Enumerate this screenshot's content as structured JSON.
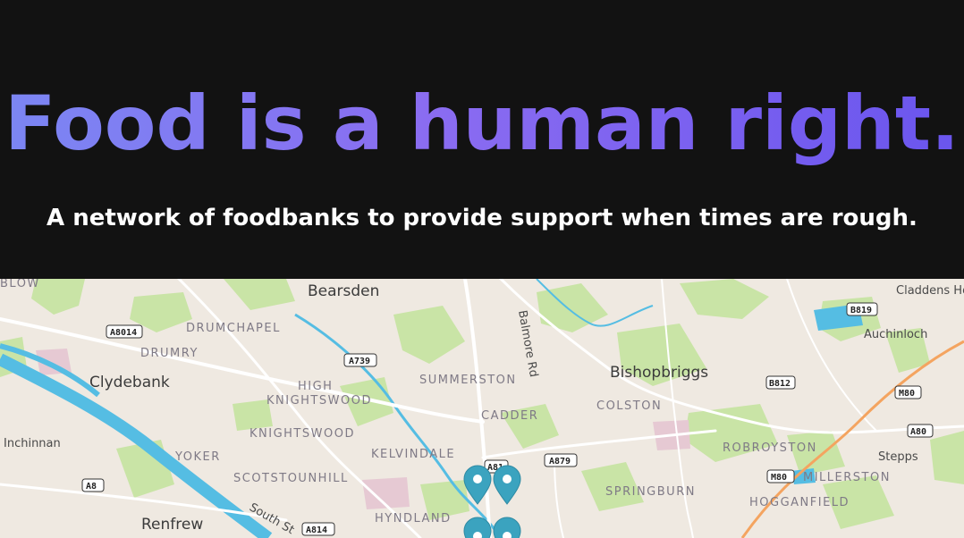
{
  "hero": {
    "headline": "Food is a human right.",
    "tagline": "A network of foodbanks to provide support when times are rough."
  },
  "map": {
    "colors": {
      "land": "#efe9e1",
      "water": "#55bde3",
      "park": "#c7e3a4",
      "road": "#ffffff",
      "motorway": "#f4a460",
      "pin": "#3ba3bf"
    },
    "places": {
      "blow": "BLOW",
      "bearsden": "Bearsden",
      "claddens": "Claddens Hol",
      "drumchapel": "DRUMCHAPEL",
      "drumry": "DRUMRY",
      "clydebank": "Clydebank",
      "high": "HIGH",
      "knightswood_high": "KNIGHTSWOOD",
      "summerston": "SUMMERSTON",
      "cadder": "CADDER",
      "bishopbriggs": "Bishopbriggs",
      "colston": "COLSTON",
      "auchinloch": "Auchinloch",
      "inchinnan": "Inchinnan",
      "knightswood": "KNIGHTSWOOD",
      "kelvindale": "KELVINDALE",
      "robroyston": "ROBROYSTON",
      "yoker": "YOKER",
      "scotstounhill": "SCOTSTOUNHILL",
      "stepps": "Stepps",
      "millerston": "MILLERSTON",
      "springburn": "SPRINGBURN",
      "hogganfield": "HOGGANFIELD",
      "renfrew": "Renfrew",
      "hyndland": "HYNDLAND",
      "balmore_rd": "Balmore Rd",
      "south_st": "South St"
    },
    "roads": {
      "a8014": "A8014",
      "a739": "A739",
      "a879": "A879",
      "a8": "A8",
      "a814": "A814",
      "a81": "A81",
      "b819": "B819",
      "b812": "B812",
      "m80_top": "M80",
      "a80": "A80",
      "m80_bottom": "M80"
    },
    "markers_count": 4
  }
}
